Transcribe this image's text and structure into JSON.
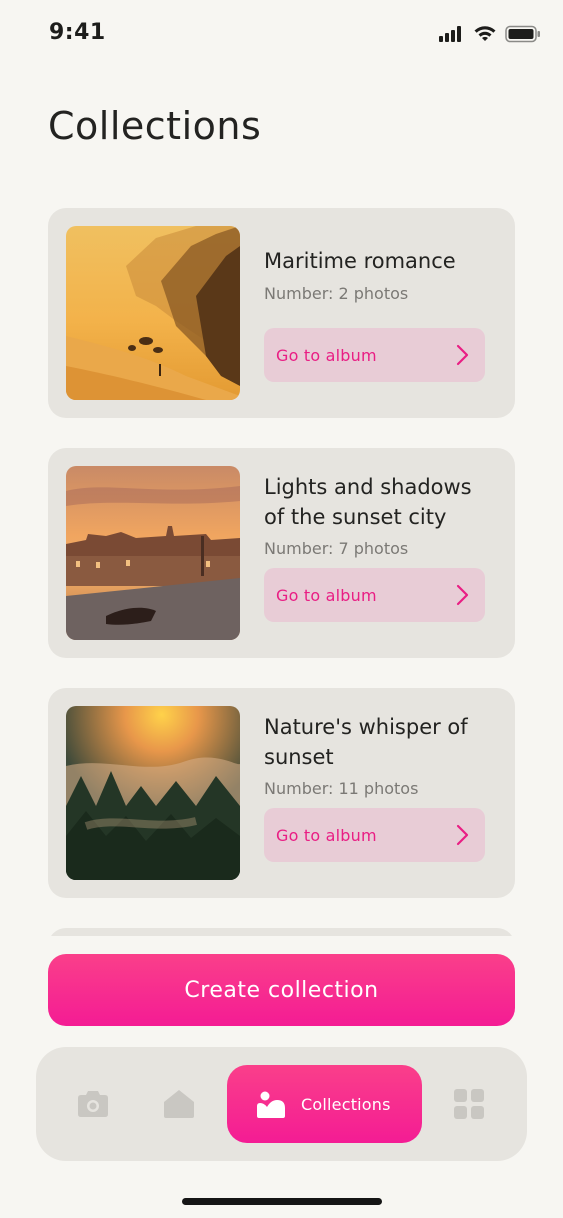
{
  "status_bar": {
    "time": "9:41"
  },
  "page": {
    "title": "Collections"
  },
  "collections": [
    {
      "title": "Maritime romance",
      "count": "Number: 2 photos",
      "button_label": "Go to album"
    },
    {
      "title": "Lights and shadows of the sunset city",
      "count": "Number: 7 photos",
      "button_label": "Go to album"
    },
    {
      "title": "Nature's whisper of sunset",
      "count": "Number: 11 photos",
      "button_label": "Go to album"
    }
  ],
  "create_button": {
    "label": "Create collection"
  },
  "tab_bar": {
    "tabs": [
      {
        "icon": "camera-icon",
        "active": false
      },
      {
        "icon": "home-icon",
        "active": false
      },
      {
        "icon": "image-icon",
        "label": "Collections",
        "active": true
      },
      {
        "icon": "grid-icon",
        "active": false
      }
    ]
  },
  "colors": {
    "accent": "#f41c94",
    "accent_light": "#e8ccd6",
    "card_bg": "#e6e4df",
    "page_bg": "#f7f6f2",
    "inactive_icon": "#c9c7c2"
  }
}
